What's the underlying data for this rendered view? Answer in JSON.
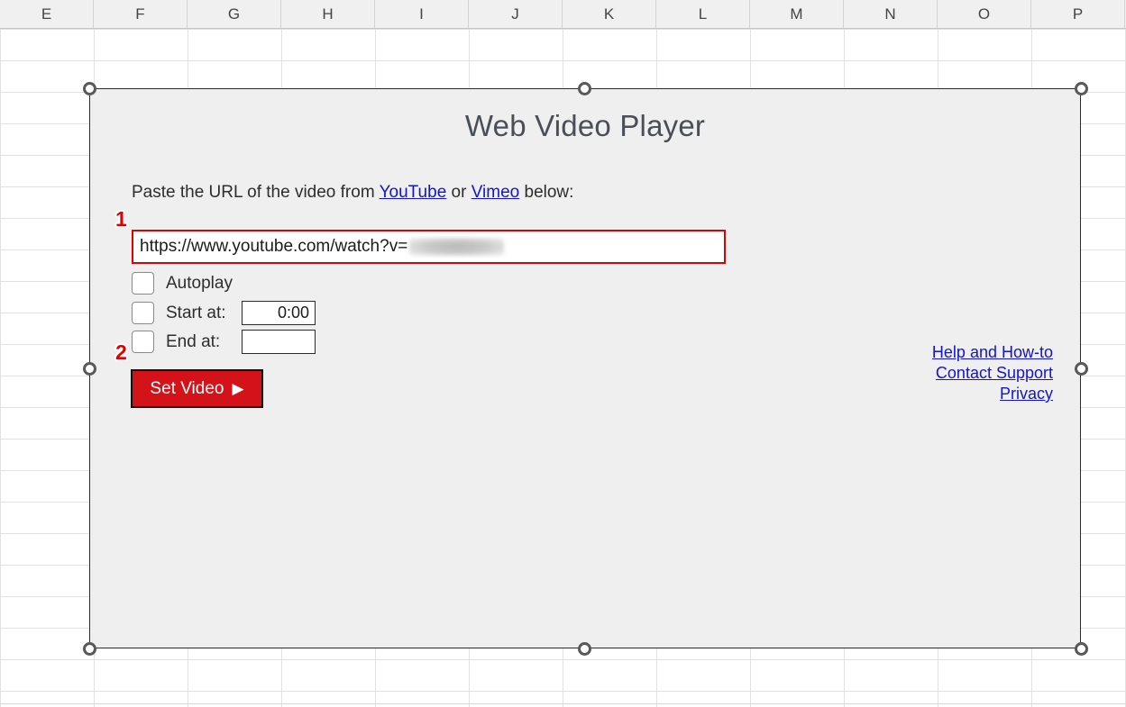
{
  "spreadsheet": {
    "column_headers": [
      "E",
      "F",
      "G",
      "H",
      "I",
      "J",
      "K",
      "L",
      "M",
      "N",
      "O",
      "P"
    ],
    "grid_color": "#e2e2e2",
    "header_bg": "#f0f0f0"
  },
  "app": {
    "title": "Web Video Player",
    "instruction": {
      "prefix": "Paste the URL of the video from ",
      "link_youtube": "YouTube",
      "middle": " or ",
      "link_vimeo": "Vimeo",
      "suffix": " below:"
    },
    "url_input": {
      "value": "https://www.youtube.com/watch?v=",
      "redacted": true,
      "highlight_color": "#e00000"
    },
    "options": [
      {
        "label": "Autoplay",
        "checked": false
      },
      {
        "label": "Start at:",
        "checked": false,
        "value": "0:00"
      },
      {
        "label": "End at:",
        "checked": false,
        "value": ""
      }
    ],
    "set_video_button": {
      "label": "Set Video",
      "icon": "play-triangle",
      "glyph": "▶",
      "bg_color": "#d4121a",
      "text_color": "#ffffff"
    },
    "side_links": [
      "Help and How-to",
      "Contact Support",
      "Privacy"
    ],
    "link_color": "#1414d0",
    "panel_bg": "#efefef"
  },
  "annotations": {
    "steps": [
      {
        "number": "1",
        "target": "url-input"
      },
      {
        "number": "2",
        "target": "set-video-button"
      }
    ],
    "color": "#e00000"
  },
  "selection": {
    "selected": true,
    "handle_count": 6
  }
}
